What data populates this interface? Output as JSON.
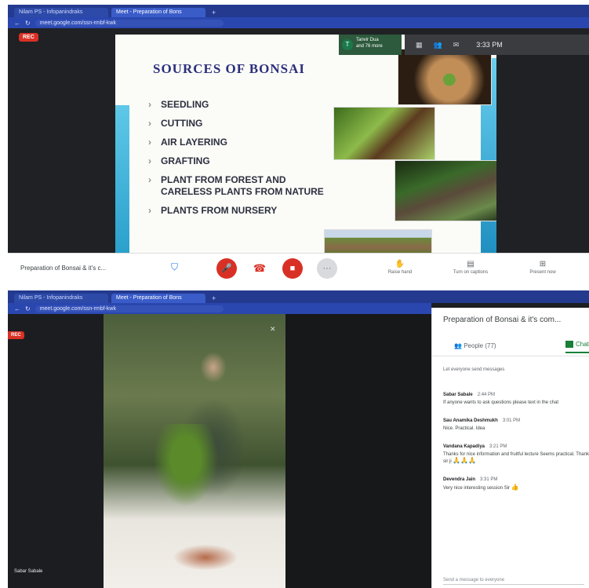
{
  "top": {
    "tabs": [
      "Nilam PS - Infopanindraks",
      "Meet - Preparation of Bons"
    ],
    "url": "meet.google.com/ssn-rmbf-kwk",
    "rec_badge": "REC",
    "presenter_tile": {
      "avatar": "T",
      "line1": "Tanvir Dua",
      "line2": "and 76 more"
    },
    "time": "3:33 PM",
    "slide": {
      "title": "SOURCES OF BONSAI",
      "bullets": [
        "SEEDLING",
        "CUTTING",
        "AIR LAYERING",
        "GRAFTING",
        "PLANT FROM FOREST AND CARELESS PLANTS FROM NATURE",
        "PLANTS FROM NURSERY"
      ]
    },
    "controls": {
      "meeting_name": "Preparation of Bonsai & it's c...",
      "raise_hand": "Raise hand",
      "turn_on_captions": "Turn on captions",
      "present_now": "Present now"
    }
  },
  "bottom": {
    "tabs": [
      "Nilam PS - Infopanindraks",
      "Meet - Preparation of Bons"
    ],
    "url": "meet.google.com/ssn-rmbf-kwk",
    "rec_badge": "REC",
    "speaker_name": "Sabar Sabale",
    "chat": {
      "title": "Preparation of Bonsai & it's com...",
      "people_tab": "People (77)",
      "chat_tab": "Chat",
      "notice": "Let everyone send messages",
      "messages": [
        {
          "who": "Sabar Sabale",
          "at": "2:44 PM",
          "text": "If anyone wants to ask questions please text in the chat"
        },
        {
          "who": "Sau Anamika Deshmukh",
          "at": "3:01 PM",
          "text": "Nice. Practical. Idea"
        },
        {
          "who": "Vandana Kapadiya",
          "at": "3:21 PM",
          "text": "Thanks for nice information and fruitful lecture Seems practical. Thanks sir ji",
          "emoji": "🙏🙏🙏"
        },
        {
          "who": "Devendra Jain",
          "at": "3:31 PM",
          "text": "Very nice interesting session Sir",
          "emoji": "👍"
        }
      ],
      "compose_placeholder": "Send a message to everyone"
    }
  }
}
